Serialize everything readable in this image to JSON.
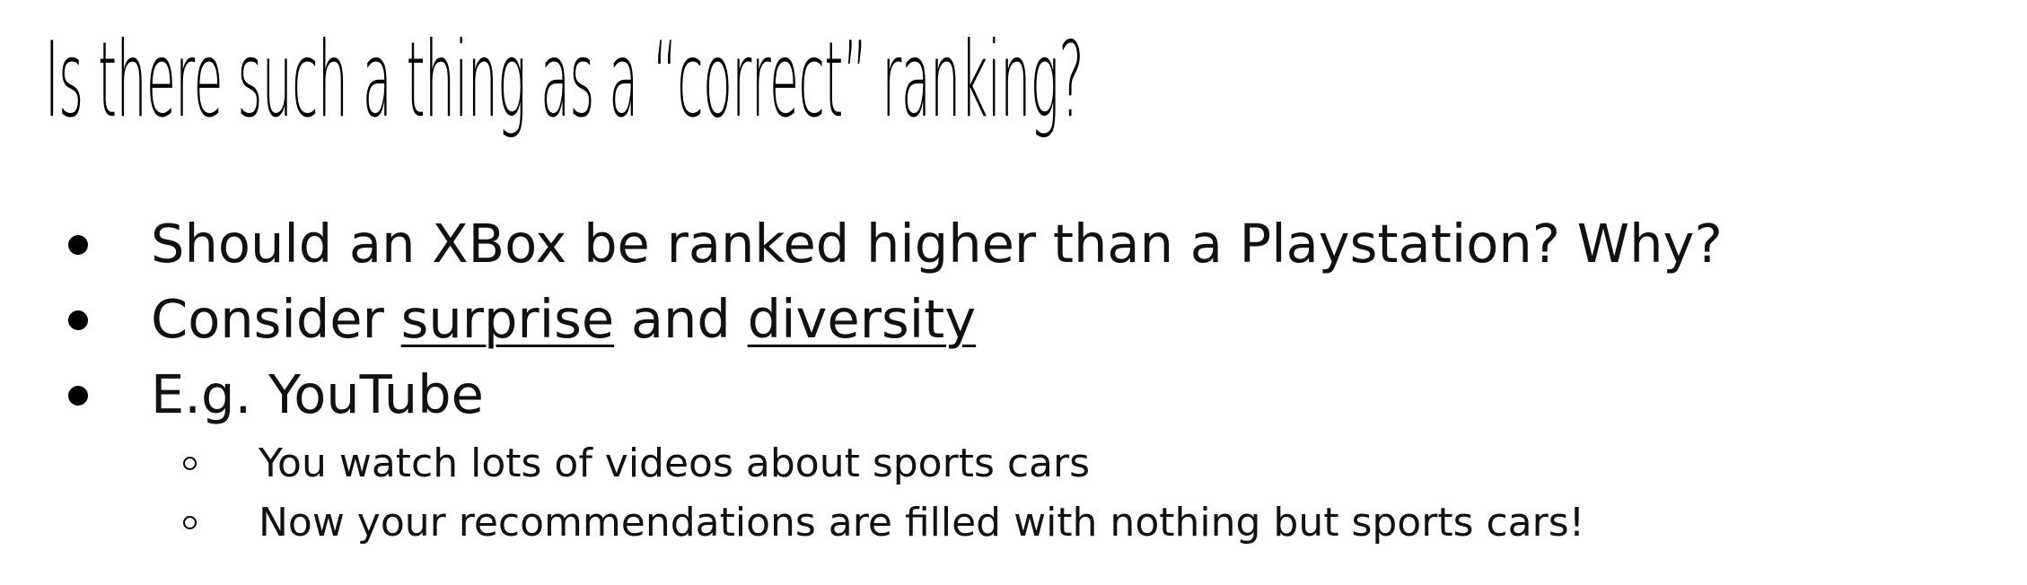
{
  "slide": {
    "title": "Is there such a thing as a “correct” ranking?",
    "bullets": [
      {
        "text": "Should an XBox be ranked higher than a Playstation? Why?"
      },
      {
        "prefix": "Consider ",
        "term1": "surprise",
        "middle": " and ",
        "term2": "diversity"
      },
      {
        "text": "E.g. YouTube",
        "subitems": [
          {
            "text": "You watch lots of videos about sports cars"
          },
          {
            "text": "Now your recommendations are filled with nothing but sports cars!"
          }
        ]
      }
    ]
  }
}
